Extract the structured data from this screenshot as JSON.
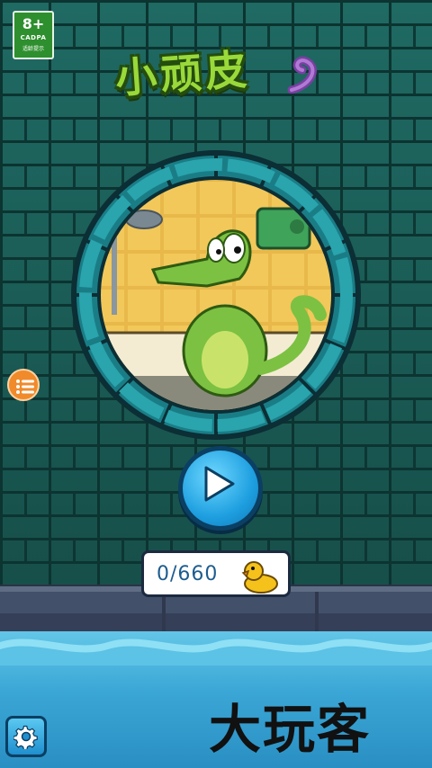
{
  "age_rating": {
    "age": "8+",
    "code": "CADPA",
    "label": "适龄提示"
  },
  "title": "小顽皮",
  "play_button_icon": "play-icon",
  "score": {
    "value": "0/660",
    "icon": "rubber-duck-icon"
  },
  "menu_icon": "list-icon",
  "settings_icon": "gear-icon",
  "watermark": "大玩客",
  "colors": {
    "wall": "#1f6a63",
    "water": "#3aa6d5",
    "title": "#9ad93a",
    "accent": "#f08a2b",
    "play": "#1e9fe0"
  }
}
